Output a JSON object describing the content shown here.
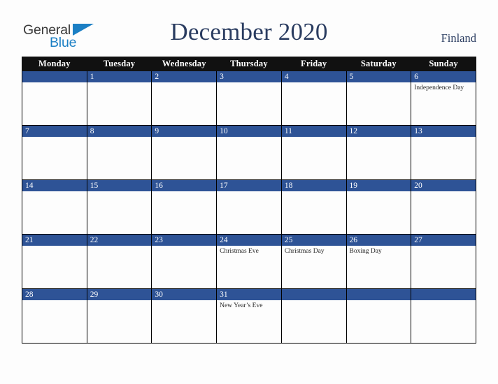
{
  "brand": {
    "name_part1": "General",
    "name_part2": "Blue",
    "accent_color": "#1b7fc4",
    "text_color": "#3b3b3b"
  },
  "header": {
    "title": "December 2020",
    "country": "Finland",
    "title_color": "#2a3c60"
  },
  "calendar": {
    "weekday_headers": [
      "Monday",
      "Tuesday",
      "Wednesday",
      "Thursday",
      "Friday",
      "Saturday",
      "Sunday"
    ],
    "header_bg": "#111111",
    "date_bar_bg": "#2e5396",
    "cell_bg": "#fdfdfd",
    "weeks": [
      [
        {
          "day": "",
          "events": []
        },
        {
          "day": "1",
          "events": []
        },
        {
          "day": "2",
          "events": []
        },
        {
          "day": "3",
          "events": []
        },
        {
          "day": "4",
          "events": []
        },
        {
          "day": "5",
          "events": []
        },
        {
          "day": "6",
          "events": [
            "Independence Day"
          ]
        }
      ],
      [
        {
          "day": "7",
          "events": []
        },
        {
          "day": "8",
          "events": []
        },
        {
          "day": "9",
          "events": []
        },
        {
          "day": "10",
          "events": []
        },
        {
          "day": "11",
          "events": []
        },
        {
          "day": "12",
          "events": []
        },
        {
          "day": "13",
          "events": []
        }
      ],
      [
        {
          "day": "14",
          "events": []
        },
        {
          "day": "15",
          "events": []
        },
        {
          "day": "16",
          "events": []
        },
        {
          "day": "17",
          "events": []
        },
        {
          "day": "18",
          "events": []
        },
        {
          "day": "19",
          "events": []
        },
        {
          "day": "20",
          "events": []
        }
      ],
      [
        {
          "day": "21",
          "events": []
        },
        {
          "day": "22",
          "events": []
        },
        {
          "day": "23",
          "events": []
        },
        {
          "day": "24",
          "events": [
            "Christmas Eve"
          ]
        },
        {
          "day": "25",
          "events": [
            "Christmas Day"
          ]
        },
        {
          "day": "26",
          "events": [
            "Boxing Day"
          ]
        },
        {
          "day": "27",
          "events": []
        }
      ],
      [
        {
          "day": "28",
          "events": []
        },
        {
          "day": "29",
          "events": []
        },
        {
          "day": "30",
          "events": []
        },
        {
          "day": "31",
          "events": [
            "New Year’s Eve"
          ]
        },
        {
          "day": "",
          "events": []
        },
        {
          "day": "",
          "events": []
        },
        {
          "day": "",
          "events": []
        }
      ]
    ]
  }
}
